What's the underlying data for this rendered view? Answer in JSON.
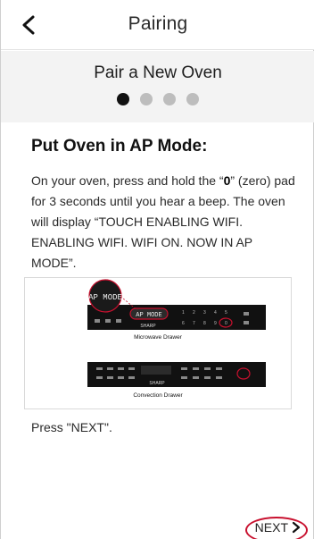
{
  "header": {
    "title": "Pairing",
    "back_icon": "chevron-left-icon"
  },
  "subheader": {
    "title": "Pair a New Oven",
    "steps_total": 4,
    "current_step": 1
  },
  "content": {
    "section_title": "Put Oven in AP Mode:",
    "instructions_part1": "On your oven, press and hold the “",
    "instructions_bold": "0",
    "instructions_part2": "” (zero) pad for 3 seconds until you hear a beep. The oven will display “TOUCH ENABLING WIFI. ENABLING WIFI. WIFI ON. NOW IN AP MODE”.",
    "press_next": "Press \"NEXT\"."
  },
  "figure": {
    "magnified_display": "AP MODE",
    "panel_display": "AP MODE",
    "brand": "SHARP",
    "microwave_label": "Microwave Drawer",
    "convection_label": "Convection Drawer",
    "highlight_color": "#c8102e"
  },
  "footer": {
    "next_label": "NEXT",
    "next_icon": "chevron-right-icon"
  }
}
